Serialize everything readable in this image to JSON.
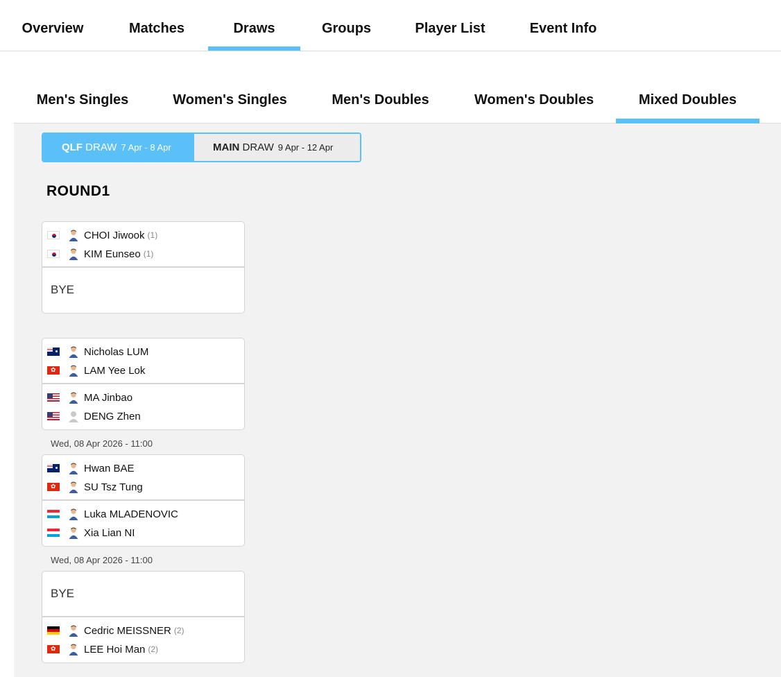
{
  "top_tabs": [
    "Overview",
    "Matches",
    "Draws",
    "Groups",
    "Player List",
    "Event Info"
  ],
  "top_active": "Draws",
  "event_tabs": [
    "Men's Singles",
    "Women's Singles",
    "Men's Doubles",
    "Women's Doubles",
    "Mixed Doubles"
  ],
  "event_active": "Mixed Doubles",
  "draw_toggle": {
    "qlf": {
      "label_a": "QLF",
      "label_b": "DRAW",
      "dates": "7 Apr - 8 Apr"
    },
    "main": {
      "label_a": "MAIN",
      "label_b": "DRAW",
      "dates": "9 Apr - 12 Apr"
    }
  },
  "round_title": "ROUND1",
  "matches": [
    {
      "top": {
        "players": [
          {
            "flag": "flag-kr",
            "avatar": "player-avatar-icon",
            "name": "CHOI Jiwook",
            "seed": "(1)"
          },
          {
            "flag": "flag-kr",
            "avatar": "player-avatar-icon",
            "name": "KIM Eunseo",
            "seed": "(1)"
          }
        ]
      },
      "bottom": {
        "bye": "BYE"
      },
      "time": ""
    },
    {
      "top": {
        "players": [
          {
            "flag": "flag-au",
            "avatar": "player-avatar-icon",
            "name": "Nicholas LUM",
            "seed": ""
          },
          {
            "flag": "flag-hk",
            "avatar": "player-avatar-icon",
            "name": "LAM Yee Lok",
            "seed": ""
          }
        ]
      },
      "bottom": {
        "players": [
          {
            "flag": "flag-us",
            "avatar": "player-avatar-icon",
            "name": "MA Jinbao",
            "seed": ""
          },
          {
            "flag": "flag-us",
            "avatar": "default-avatar-icon",
            "name": "DENG Zhen",
            "seed": ""
          }
        ]
      },
      "time": "Wed, 08 Apr 2026 - 11:00"
    },
    {
      "top": {
        "players": [
          {
            "flag": "flag-au",
            "avatar": "player-avatar-icon",
            "name": "Hwan BAE",
            "seed": ""
          },
          {
            "flag": "flag-hk",
            "avatar": "player-avatar-icon",
            "name": "SU Tsz Tung",
            "seed": ""
          }
        ]
      },
      "bottom": {
        "players": [
          {
            "flag": "flag-lu",
            "avatar": "player-avatar-icon",
            "name": "Luka MLADENOVIC",
            "seed": ""
          },
          {
            "flag": "flag-lu",
            "avatar": "player-avatar-icon",
            "name": "Xia Lian NI",
            "seed": ""
          }
        ]
      },
      "time": "Wed, 08 Apr 2026 - 11:00"
    },
    {
      "top": {
        "bye": "BYE"
      },
      "bottom": {
        "players": [
          {
            "flag": "flag-de",
            "avatar": "player-avatar-icon",
            "name": "Cedric MEISSNER",
            "seed": "(2)"
          },
          {
            "flag": "flag-hk",
            "avatar": "player-avatar-icon",
            "name": "LEE Hoi Man",
            "seed": "(2)"
          }
        ]
      },
      "time": ""
    }
  ],
  "colors": {
    "accent": "#5bc0f8",
    "content_bg": "#f2f2f2"
  }
}
